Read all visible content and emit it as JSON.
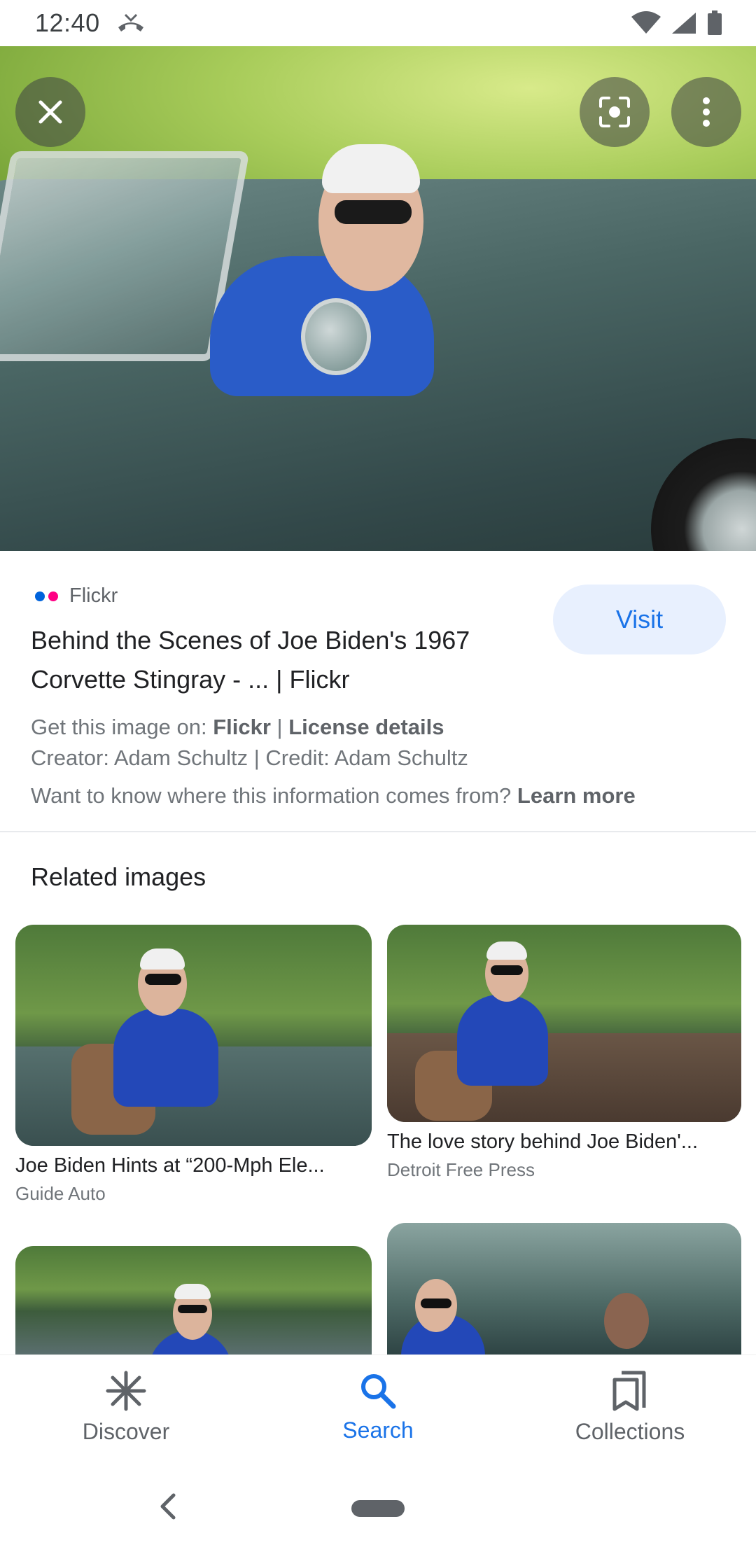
{
  "status_bar": {
    "time": "12:40",
    "icons": [
      "missed-call-icon",
      "wifi-icon",
      "signal-icon",
      "battery-icon"
    ]
  },
  "hero": {
    "buttons": {
      "close": "close-icon",
      "lens": "lens-icon",
      "more": "more-vert-icon"
    }
  },
  "result": {
    "source": "Flickr",
    "title": "Behind the Scenes of Joe Biden's 1967 Corvette Stingray - ... | Flickr",
    "visit_label": "Visit",
    "get_image_prefix": "Get this image on: ",
    "get_image_source": "Flickr",
    "separator": " | ",
    "license_label": "License details",
    "creator_line": "Creator: Adam Schultz | Credit: Adam Schultz",
    "info_question": "Want to know where this information comes from? ",
    "learn_more": "Learn more"
  },
  "related": {
    "heading": "Related images",
    "items": [
      {
        "title": "Joe Biden Hints at “200-Mph Ele...",
        "source": "Guide Auto"
      },
      {
        "title": "The love story behind Joe Biden'...",
        "source": "Detroit Free Press"
      },
      {
        "title": "",
        "source": ""
      },
      {
        "title": "",
        "source": ""
      }
    ]
  },
  "bottom_nav": {
    "items": [
      {
        "label": "Discover",
        "icon": "asterisk-icon"
      },
      {
        "label": "Search",
        "icon": "search-icon",
        "active": true
      },
      {
        "label": "Collections",
        "icon": "collections-icon"
      }
    ]
  },
  "colors": {
    "accent": "#1a73e8",
    "visit_bg": "#e8f0fe",
    "flickr_blue": "#0063dc",
    "flickr_pink": "#ff0084"
  }
}
